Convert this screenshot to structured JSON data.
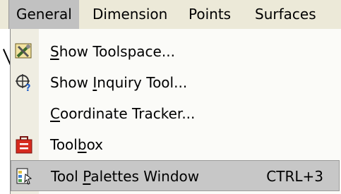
{
  "menubar": {
    "items": [
      {
        "label": "General",
        "active": true
      },
      {
        "label": "Dimension"
      },
      {
        "label": "Points"
      },
      {
        "label": "Surfaces"
      }
    ]
  },
  "dropdown": {
    "items": [
      {
        "pre": "",
        "ul": "S",
        "post": "how Toolspace...",
        "icon": "toolspace-icon"
      },
      {
        "pre": "Show ",
        "ul": "I",
        "post": "nquiry Tool...",
        "icon": "inquiry-tool-icon"
      },
      {
        "pre": "",
        "ul": "C",
        "post": "oordinate Tracker...",
        "icon": ""
      },
      {
        "pre": "Tool",
        "ul": "b",
        "post": "ox",
        "icon": "toolbox-icon"
      },
      {
        "pre": "Tool ",
        "ul": "P",
        "post": "alettes Window",
        "icon": "tool-palettes-icon",
        "shortcut": "CTRL+3",
        "highlighted": true
      }
    ]
  },
  "colors": {
    "menubar_bg": "#ece9d8",
    "active_menu_bg": "#c1c1c1",
    "highlight_bg": "#c7c7c7",
    "toolbox_red": "#d62a1d"
  }
}
